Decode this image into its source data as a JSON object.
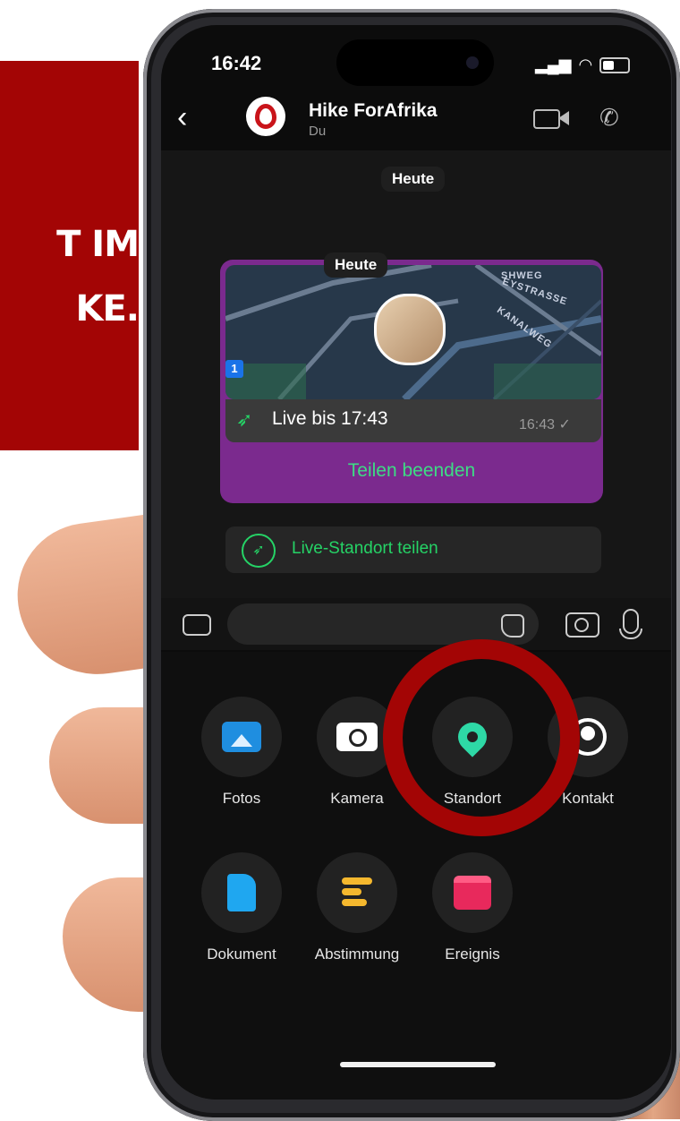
{
  "banner": {
    "line1": "T IM",
    "line2": "KE."
  },
  "status": {
    "time": "16:42"
  },
  "chat": {
    "title": "Hike ForAfrika",
    "subtitle": "Du",
    "date_pill": "Heute",
    "bubble_date_pill": "Heute",
    "map": {
      "badge": "1",
      "street1": "SHWEG",
      "street2": "EYSTRASSE",
      "street3": "KANALWEG"
    },
    "live_text": "Live bis 17:43",
    "live_time": "16:43 ✓",
    "stop_label": "Teilen beenden",
    "share_label": "Live-Standort teilen"
  },
  "tray": {
    "items": [
      {
        "label": "Fotos",
        "icon": "photos-icon"
      },
      {
        "label": "Kamera",
        "icon": "camera-icon"
      },
      {
        "label": "Standort",
        "icon": "location-pin-icon"
      },
      {
        "label": "Kontakt",
        "icon": "contact-icon"
      },
      {
        "label": "Dokument",
        "icon": "document-icon"
      },
      {
        "label": "Abstimmung",
        "icon": "poll-icon"
      },
      {
        "label": "Ereignis",
        "icon": "event-calendar-icon"
      }
    ]
  },
  "colors": {
    "brand_red": "#a30505",
    "whatsapp_green": "#25d366",
    "bubble_purple": "#7b2a8e",
    "pin_teal": "#2ed9a6"
  }
}
